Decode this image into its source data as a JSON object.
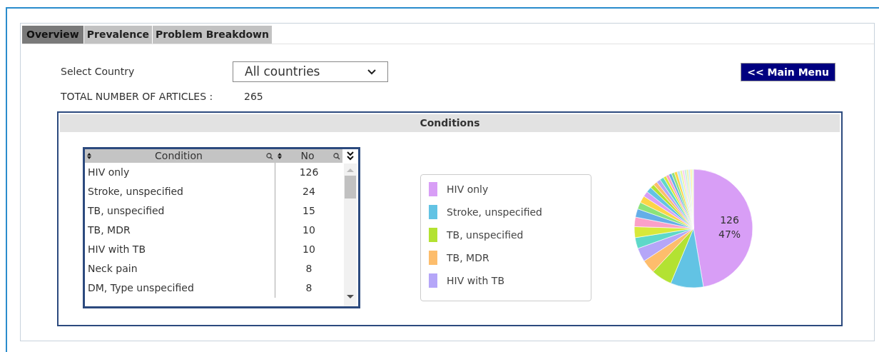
{
  "tabs": [
    {
      "label": "Overview",
      "selected": true
    },
    {
      "label": "Prevalence",
      "selected": false
    },
    {
      "label": "Problem Breakdown",
      "selected": false
    }
  ],
  "country": {
    "label": "Select Country",
    "value": "All countries"
  },
  "total": {
    "label": "TOTAL NUMBER OF ARTICLES :",
    "value": "265"
  },
  "main_menu_button": "<< Main Menu",
  "conditions": {
    "title": "Conditions",
    "table": {
      "columns": [
        "Condition",
        "No"
      ],
      "rows": [
        {
          "condition": "HIV only",
          "no": "126"
        },
        {
          "condition": "Stroke, unspecified",
          "no": "24"
        },
        {
          "condition": "TB, unspecified",
          "no": "15"
        },
        {
          "condition": "TB, MDR",
          "no": "10"
        },
        {
          "condition": "HIV with TB",
          "no": "10"
        },
        {
          "condition": "Neck pain",
          "no": "8"
        },
        {
          "condition": "DM, Type unspecified",
          "no": "8"
        }
      ]
    },
    "legend": [
      {
        "label": "HIV only",
        "color": "#d89ef6"
      },
      {
        "label": "Stroke, unspecified",
        "color": "#62c3e4"
      },
      {
        "label": "TB, unspecified",
        "color": "#b3e232"
      },
      {
        "label": "TB, MDR",
        "color": "#fdbd6c"
      },
      {
        "label": "HIV with TB",
        "color": "#b5a6f8"
      }
    ],
    "pie_label": {
      "value": "126",
      "percent": "47%"
    }
  }
}
